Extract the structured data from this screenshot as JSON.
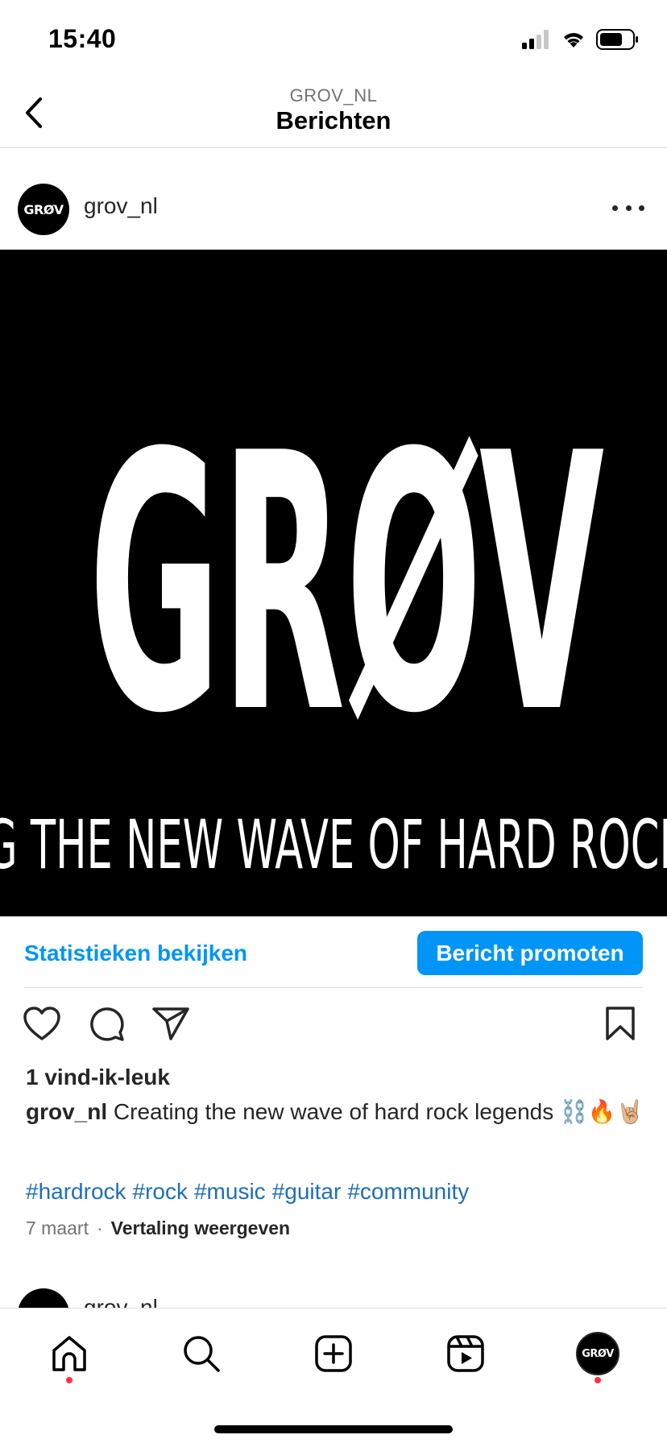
{
  "status_bar": {
    "time": "15:40"
  },
  "header": {
    "subtitle": "GROV_NL",
    "title": "Berichten"
  },
  "post": {
    "username": "grov_nl",
    "avatar_text": "GRØV",
    "image": {
      "logo_text": "GRØV",
      "tagline": "G THE NEW WAVE OF HARD ROCK"
    },
    "stats_link": "Statistieken bekijken",
    "promote_button": "Bericht promoten",
    "likes": "1 vind-ik-leuk",
    "caption_user": "grov_nl",
    "caption_text": " Creating the new wave of hard rock legends ⛓️🔥🤘🏼",
    "hashtags": [
      "#hardrock",
      "#rock",
      "#music",
      "#guitar",
      "#community"
    ],
    "date": "7 maart",
    "separator": "·",
    "translate": "Vertaling weergeven"
  },
  "next_post": {
    "username": "grov_nl"
  },
  "tab_bar": {
    "profile_avatar_text": "GRØV",
    "notification_color": "#ff3040"
  },
  "colors": {
    "accent": "#0095f6",
    "hashtag": "#1e6fb5"
  }
}
